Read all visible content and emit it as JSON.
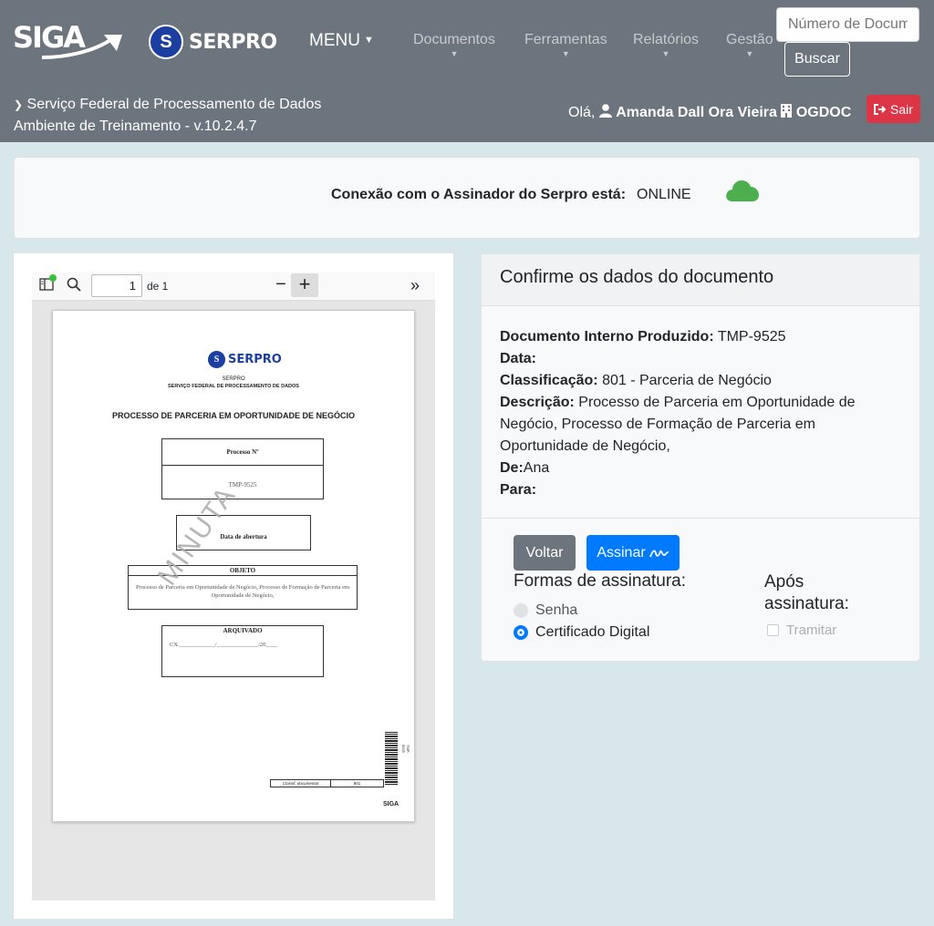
{
  "header": {
    "brand": "SIGA",
    "serpro": "SERPRO",
    "menu_label": "MENU",
    "nav": [
      "Documentos",
      "Ferramentas",
      "Relatórios",
      "Gestão"
    ],
    "search_placeholder": "Número de Documento",
    "search_button": "Buscar",
    "org_name": "Serviço Federal de Processamento de Dados",
    "env": "Ambiente de Treinamento - v.10.2.4.7",
    "greeting": "Olá,",
    "user": "Amanda Dall Ora Vieira",
    "unit": "OGDOC",
    "logout": "Sair"
  },
  "connection": {
    "label": "Conexão com o Assinador do Serpro está:",
    "status": "ONLINE",
    "status_color": "#4cae4c"
  },
  "pdf": {
    "page": "1",
    "of": "de 1",
    "logo_text": "SERPRO",
    "org1": "SERPRO",
    "org2": "SERVIÇO FEDERAL DE PROCESSAMENTO DE DADOS",
    "title": "PROCESSO DE PARCERIA EM OPORTUNIDADE DE NEGÓCIO",
    "processo_label": "Processo Nº",
    "processo_num": "TMP-9525",
    "abertura_label": "Data de abertura",
    "objeto_label": "OBJETO",
    "objeto_text": "Processo de Parceria em Oportunidade de Negócio, Processo de Formação de Parceria em Oportunidade de Negócio,",
    "arquivado_label": "ARQUIVADO",
    "arquivado_line": "CX.____________/______________/20____",
    "watermark": "MINUTA",
    "barcode_text": "TMP-9525",
    "class_label": "Classif. documental",
    "class_value": "801",
    "footer_logo": "SIGA"
  },
  "confirm": {
    "title": "Confirme os dados do documento",
    "doc_label": "Documento Interno Produzido:",
    "doc_value": "TMP-9525",
    "data_label": "Data:",
    "class_label": "Classificação:",
    "class_value": "801 - Parceria de Negócio",
    "desc_label": "Descrição:",
    "desc_value": "Processo de Parceria em Oportunidade de Negócio, Processo de Formação de Parceria em Oportunidade de Negócio,",
    "de_label": "De:",
    "de_value": "Ana",
    "para_label": "Para:",
    "btn_voltar": "Voltar",
    "btn_assinar": "Assinar",
    "formas_label": "Formas de assinatura:",
    "opt_senha": "Senha",
    "opt_cert": "Certificado Digital",
    "apos_label": "Após assinatura:",
    "tramitar": "Tramitar"
  }
}
